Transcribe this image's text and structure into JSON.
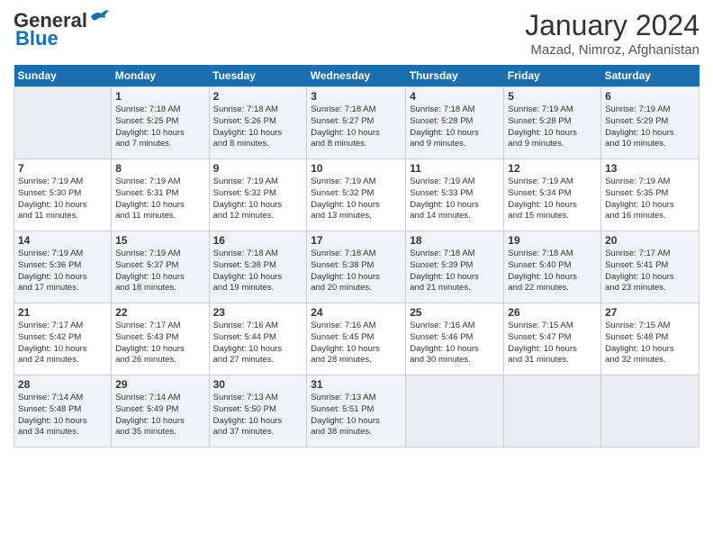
{
  "header": {
    "logo_general": "General",
    "logo_blue": "Blue",
    "month": "January 2024",
    "location": "Mazad, Nimroz, Afghanistan"
  },
  "days_of_week": [
    "Sunday",
    "Monday",
    "Tuesday",
    "Wednesday",
    "Thursday",
    "Friday",
    "Saturday"
  ],
  "weeks": [
    [
      {
        "day": "",
        "info": ""
      },
      {
        "day": "1",
        "info": "Sunrise: 7:18 AM\nSunset: 5:25 PM\nDaylight: 10 hours\nand 7 minutes."
      },
      {
        "day": "2",
        "info": "Sunrise: 7:18 AM\nSunset: 5:26 PM\nDaylight: 10 hours\nand 8 minutes."
      },
      {
        "day": "3",
        "info": "Sunrise: 7:18 AM\nSunset: 5:27 PM\nDaylight: 10 hours\nand 8 minutes."
      },
      {
        "day": "4",
        "info": "Sunrise: 7:18 AM\nSunset: 5:28 PM\nDaylight: 10 hours\nand 9 minutes."
      },
      {
        "day": "5",
        "info": "Sunrise: 7:19 AM\nSunset: 5:28 PM\nDaylight: 10 hours\nand 9 minutes."
      },
      {
        "day": "6",
        "info": "Sunrise: 7:19 AM\nSunset: 5:29 PM\nDaylight: 10 hours\nand 10 minutes."
      }
    ],
    [
      {
        "day": "7",
        "info": "Sunrise: 7:19 AM\nSunset: 5:30 PM\nDaylight: 10 hours\nand 11 minutes."
      },
      {
        "day": "8",
        "info": "Sunrise: 7:19 AM\nSunset: 5:31 PM\nDaylight: 10 hours\nand 11 minutes."
      },
      {
        "day": "9",
        "info": "Sunrise: 7:19 AM\nSunset: 5:32 PM\nDaylight: 10 hours\nand 12 minutes."
      },
      {
        "day": "10",
        "info": "Sunrise: 7:19 AM\nSunset: 5:32 PM\nDaylight: 10 hours\nand 13 minutes."
      },
      {
        "day": "11",
        "info": "Sunrise: 7:19 AM\nSunset: 5:33 PM\nDaylight: 10 hours\nand 14 minutes."
      },
      {
        "day": "12",
        "info": "Sunrise: 7:19 AM\nSunset: 5:34 PM\nDaylight: 10 hours\nand 15 minutes."
      },
      {
        "day": "13",
        "info": "Sunrise: 7:19 AM\nSunset: 5:35 PM\nDaylight: 10 hours\nand 16 minutes."
      }
    ],
    [
      {
        "day": "14",
        "info": "Sunrise: 7:19 AM\nSunset: 5:36 PM\nDaylight: 10 hours\nand 17 minutes."
      },
      {
        "day": "15",
        "info": "Sunrise: 7:19 AM\nSunset: 5:37 PM\nDaylight: 10 hours\nand 18 minutes."
      },
      {
        "day": "16",
        "info": "Sunrise: 7:18 AM\nSunset: 5:38 PM\nDaylight: 10 hours\nand 19 minutes."
      },
      {
        "day": "17",
        "info": "Sunrise: 7:18 AM\nSunset: 5:38 PM\nDaylight: 10 hours\nand 20 minutes."
      },
      {
        "day": "18",
        "info": "Sunrise: 7:18 AM\nSunset: 5:39 PM\nDaylight: 10 hours\nand 21 minutes."
      },
      {
        "day": "19",
        "info": "Sunrise: 7:18 AM\nSunset: 5:40 PM\nDaylight: 10 hours\nand 22 minutes."
      },
      {
        "day": "20",
        "info": "Sunrise: 7:17 AM\nSunset: 5:41 PM\nDaylight: 10 hours\nand 23 minutes."
      }
    ],
    [
      {
        "day": "21",
        "info": "Sunrise: 7:17 AM\nSunset: 5:42 PM\nDaylight: 10 hours\nand 24 minutes."
      },
      {
        "day": "22",
        "info": "Sunrise: 7:17 AM\nSunset: 5:43 PM\nDaylight: 10 hours\nand 26 minutes."
      },
      {
        "day": "23",
        "info": "Sunrise: 7:16 AM\nSunset: 5:44 PM\nDaylight: 10 hours\nand 27 minutes."
      },
      {
        "day": "24",
        "info": "Sunrise: 7:16 AM\nSunset: 5:45 PM\nDaylight: 10 hours\nand 28 minutes."
      },
      {
        "day": "25",
        "info": "Sunrise: 7:16 AM\nSunset: 5:46 PM\nDaylight: 10 hours\nand 30 minutes."
      },
      {
        "day": "26",
        "info": "Sunrise: 7:15 AM\nSunset: 5:47 PM\nDaylight: 10 hours\nand 31 minutes."
      },
      {
        "day": "27",
        "info": "Sunrise: 7:15 AM\nSunset: 5:48 PM\nDaylight: 10 hours\nand 32 minutes."
      }
    ],
    [
      {
        "day": "28",
        "info": "Sunrise: 7:14 AM\nSunset: 5:48 PM\nDaylight: 10 hours\nand 34 minutes."
      },
      {
        "day": "29",
        "info": "Sunrise: 7:14 AM\nSunset: 5:49 PM\nDaylight: 10 hours\nand 35 minutes."
      },
      {
        "day": "30",
        "info": "Sunrise: 7:13 AM\nSunset: 5:50 PM\nDaylight: 10 hours\nand 37 minutes."
      },
      {
        "day": "31",
        "info": "Sunrise: 7:13 AM\nSunset: 5:51 PM\nDaylight: 10 hours\nand 38 minutes."
      },
      {
        "day": "",
        "info": ""
      },
      {
        "day": "",
        "info": ""
      },
      {
        "day": "",
        "info": ""
      }
    ]
  ]
}
